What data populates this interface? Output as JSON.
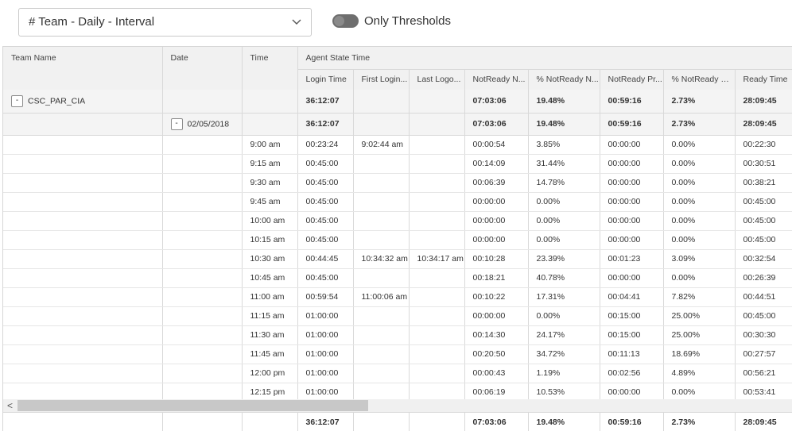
{
  "toolbar": {
    "report_name": "# Team - Daily - Interval",
    "thresholds_label": "Only Thresholds"
  },
  "columns": {
    "team_name": "Team Name",
    "date": "Date",
    "time": "Time",
    "group": "Agent State Time",
    "sub": [
      "Login Time",
      "First Login...",
      "Last Logo...",
      "NotReady N...",
      "% NotReady N...",
      "NotReady Pr...",
      "% NotReady Pr...",
      "Ready Time"
    ]
  },
  "team_row": {
    "collapse": "-",
    "team": "CSC_PAR_CIA",
    "values": [
      "36:12:07",
      "",
      "",
      "07:03:06",
      "19.48%",
      "00:59:16",
      "2.73%",
      "28:09:45"
    ]
  },
  "date_row": {
    "collapse": "-",
    "date": "02/05/2018",
    "values": [
      "36:12:07",
      "",
      "",
      "07:03:06",
      "19.48%",
      "00:59:16",
      "2.73%",
      "28:09:45"
    ]
  },
  "rows": [
    {
      "time": "9:00 am",
      "values": [
        "00:23:24",
        "9:02:44 am",
        "",
        "00:00:54",
        "3.85%",
        "00:00:00",
        "0.00%",
        "00:22:30"
      ]
    },
    {
      "time": "9:15 am",
      "values": [
        "00:45:00",
        "",
        "",
        "00:14:09",
        "31.44%",
        "00:00:00",
        "0.00%",
        "00:30:51"
      ]
    },
    {
      "time": "9:30 am",
      "values": [
        "00:45:00",
        "",
        "",
        "00:06:39",
        "14.78%",
        "00:00:00",
        "0.00%",
        "00:38:21"
      ]
    },
    {
      "time": "9:45 am",
      "values": [
        "00:45:00",
        "",
        "",
        "00:00:00",
        "0.00%",
        "00:00:00",
        "0.00%",
        "00:45:00"
      ]
    },
    {
      "time": "10:00 am",
      "values": [
        "00:45:00",
        "",
        "",
        "00:00:00",
        "0.00%",
        "00:00:00",
        "0.00%",
        "00:45:00"
      ]
    },
    {
      "time": "10:15 am",
      "values": [
        "00:45:00",
        "",
        "",
        "00:00:00",
        "0.00%",
        "00:00:00",
        "0.00%",
        "00:45:00"
      ]
    },
    {
      "time": "10:30 am",
      "values": [
        "00:44:45",
        "10:34:32 am",
        "10:34:17 am",
        "00:10:28",
        "23.39%",
        "00:01:23",
        "3.09%",
        "00:32:54"
      ]
    },
    {
      "time": "10:45 am",
      "values": [
        "00:45:00",
        "",
        "",
        "00:18:21",
        "40.78%",
        "00:00:00",
        "0.00%",
        "00:26:39"
      ]
    },
    {
      "time": "11:00 am",
      "values": [
        "00:59:54",
        "11:00:06 am",
        "",
        "00:10:22",
        "17.31%",
        "00:04:41",
        "7.82%",
        "00:44:51"
      ]
    },
    {
      "time": "11:15 am",
      "values": [
        "01:00:00",
        "",
        "",
        "00:00:00",
        "0.00%",
        "00:15:00",
        "25.00%",
        "00:45:00"
      ]
    },
    {
      "time": "11:30 am",
      "values": [
        "01:00:00",
        "",
        "",
        "00:14:30",
        "24.17%",
        "00:15:00",
        "25.00%",
        "00:30:30"
      ]
    },
    {
      "time": "11:45 am",
      "values": [
        "01:00:00",
        "",
        "",
        "00:20:50",
        "34.72%",
        "00:11:13",
        "18.69%",
        "00:27:57"
      ]
    },
    {
      "time": "12:00 pm",
      "values": [
        "01:00:00",
        "",
        "",
        "00:00:43",
        "1.19%",
        "00:02:56",
        "4.89%",
        "00:56:21"
      ]
    },
    {
      "time": "12:15 pm",
      "values": [
        "01:00:00",
        "",
        "",
        "00:06:19",
        "10.53%",
        "00:00:00",
        "0.00%",
        "00:53:41"
      ]
    }
  ],
  "footer_values": [
    "36:12:07",
    "",
    "",
    "07:03:06",
    "19.48%",
    "00:59:16",
    "2.73%",
    "28:09:45"
  ],
  "scrollbar": {
    "left_arrow": "<"
  }
}
